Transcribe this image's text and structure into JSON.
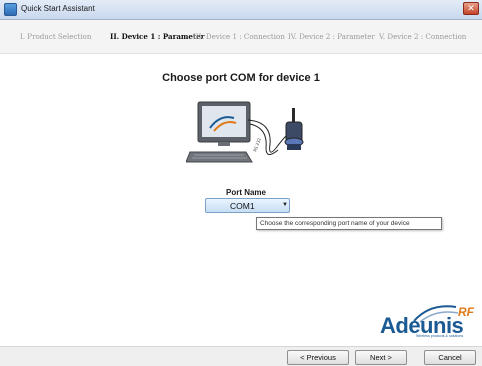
{
  "window": {
    "title": "Quick Start Assistant",
    "close_glyph": "✕"
  },
  "steps": [
    {
      "label": "I. Product Selection",
      "active": false
    },
    {
      "label": "II. Device 1 : Parameter",
      "active": true
    },
    {
      "label": "III. Device 1 : Connection",
      "active": false
    },
    {
      "label": "IV. Device 2 : Parameter",
      "active": false
    },
    {
      "label": "V. Device 2 : Connection",
      "active": false
    }
  ],
  "main": {
    "heading": "Choose port COM for device 1",
    "illustration": {
      "cable_label": "RS 232"
    },
    "port": {
      "label": "Port Name",
      "selected": "COM1",
      "tooltip": "Choose the corresponding port name of your device"
    }
  },
  "logo": {
    "name": "Adeunis",
    "rf": "RF",
    "tagline": "Wireless products & solutions"
  },
  "footer": {
    "previous_label": "< Previous",
    "next_label": "Next >",
    "cancel_label": "Cancel"
  },
  "colors": {
    "title_bar": "#c8d8ee",
    "dropdown": "#c7def4",
    "logo_blue": "#1c5a94",
    "logo_orange": "#e07a18"
  }
}
